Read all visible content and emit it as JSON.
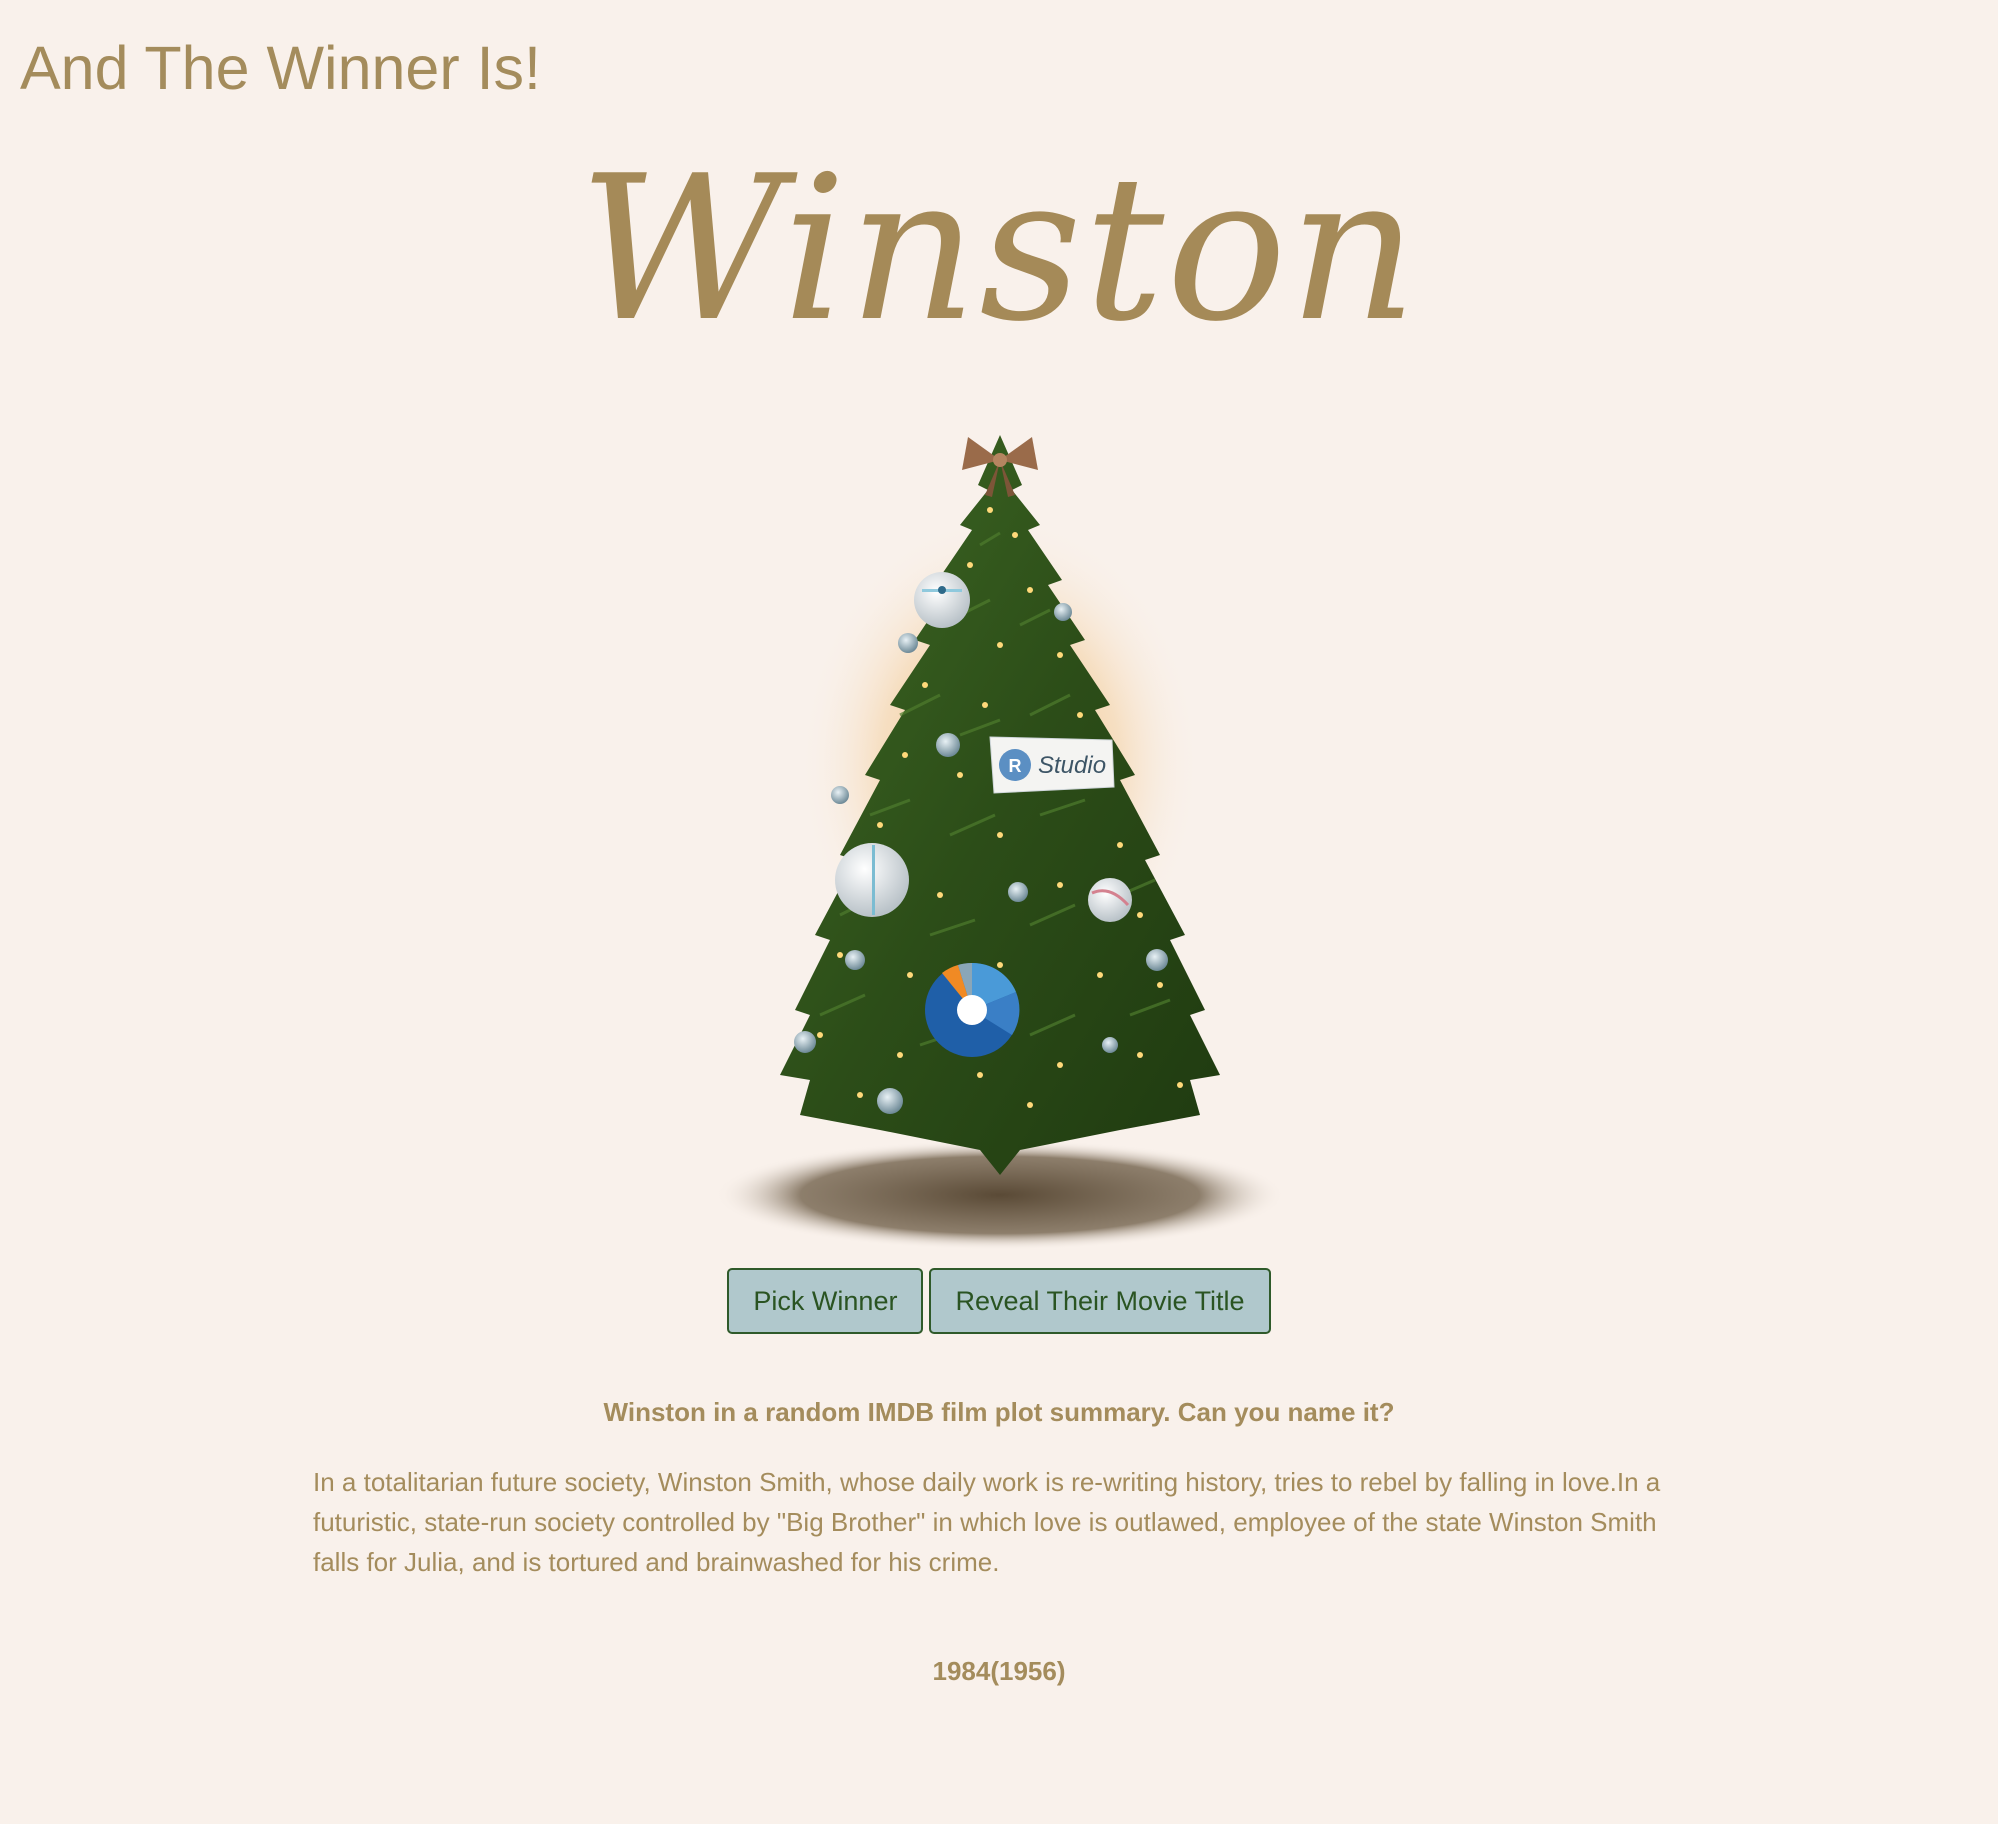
{
  "header": {
    "title": "And The Winner Is!"
  },
  "winner": {
    "name": "Winston"
  },
  "tree": {
    "ornament_label": "Studio",
    "ornament_logo_letter": "R"
  },
  "buttons": {
    "pick_winner": "Pick Winner",
    "reveal_title": "Reveal Their Movie Title"
  },
  "question": "Winston in a random IMDB film plot summary. Can you name it?",
  "summary": "In a totalitarian future society, Winston Smith, whose daily work is re-writing history, tries to rebel by falling in love.In a futuristic, state-run society controlled by \"Big Brother\" in which love is outlawed, employee of the state Winston Smith falls for Julia, and is tortured and brainwashed for his crime.",
  "movie_title": "1984(1956)",
  "colors": {
    "background": "#f9f1eb",
    "text": "#a48c5c",
    "button_fill": "#b0c8cc",
    "button_border": "#2f5a2a",
    "button_text": "#2a5422",
    "tree_green": "#2f4f1a"
  }
}
